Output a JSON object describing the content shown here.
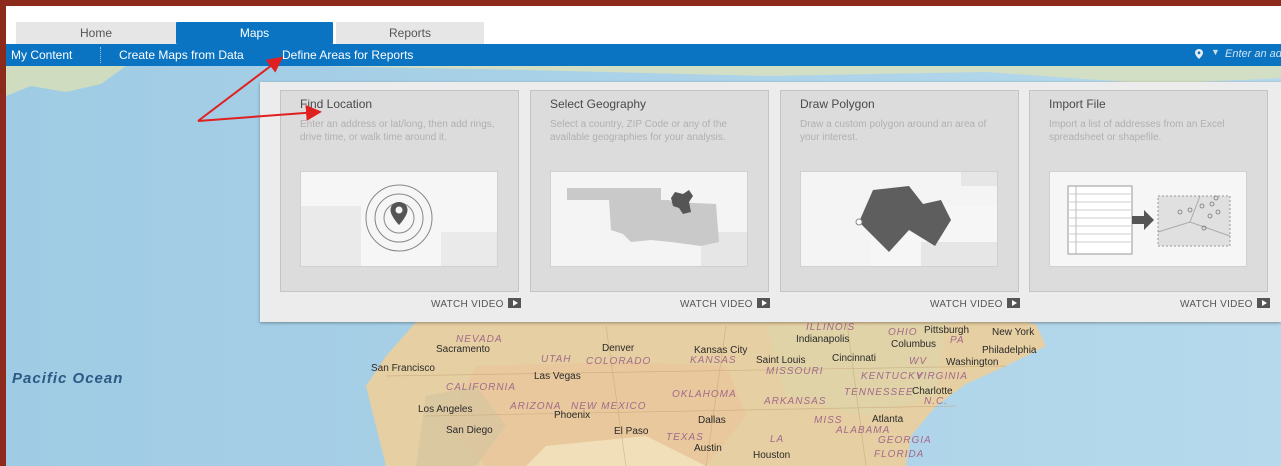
{
  "tabs": [
    {
      "label": "Home"
    },
    {
      "label": "Maps"
    },
    {
      "label": "Reports"
    }
  ],
  "ribbon": {
    "items": [
      "My Content",
      "Create Maps from Data",
      "Define Areas for Reports"
    ],
    "search_placeholder": "Enter an address"
  },
  "map_labels": {
    "ocean": "Pacific Ocean",
    "cities": [
      "San Francisco",
      "Sacramento",
      "Las Vegas",
      "Los Angeles",
      "San Diego",
      "Phoenix",
      "El Paso",
      "Denver",
      "Kansas City",
      "Saint Louis",
      "Dallas",
      "Austin",
      "Houston",
      "Indianapolis",
      "Columbus",
      "Cincinnati",
      "Pittsburgh",
      "New York",
      "Philadelphia",
      "Washington",
      "Charlotte",
      "Atlanta"
    ],
    "states": [
      "NEVADA",
      "UTAH",
      "COLORADO",
      "KANSAS",
      "MISSOURI",
      "CALIFORNIA",
      "ARIZONA",
      "NEW MEXICO",
      "OKLAHOMA",
      "ARKANSAS",
      "TEXAS",
      "LA",
      "MISS",
      "ALABAMA",
      "GEORGIA",
      "TENNESSEE",
      "KENTUCKY",
      "OHIO",
      "PA",
      "WV",
      "VIRGINIA",
      "N.C.",
      "ILLINOIS",
      "FLORIDA"
    ]
  },
  "cards": [
    {
      "title": "Find Location",
      "description": "Enter an address or lat/long, then add rings, drive time, or walk time around it.",
      "watch": "WATCH VIDEO",
      "icon": "location-rings-icon"
    },
    {
      "title": "Select Geography",
      "description": "Select a country, ZIP Code or any of the available geographies for your analysis.",
      "watch": "WATCH VIDEO",
      "icon": "state-map-icon"
    },
    {
      "title": "Draw Polygon",
      "description": "Draw a custom polygon around an area of your interest.",
      "watch": "WATCH VIDEO",
      "icon": "polygon-icon"
    },
    {
      "title": "Import File",
      "description": "Import a list of addresses from an Excel spreadsheet or shapefile.",
      "watch": "WATCH VIDEO",
      "icon": "import-file-icon"
    }
  ],
  "colors": {
    "accent": "#0b74c2",
    "frame": "#8c2b1c",
    "annotation_arrow": "#e02020"
  }
}
